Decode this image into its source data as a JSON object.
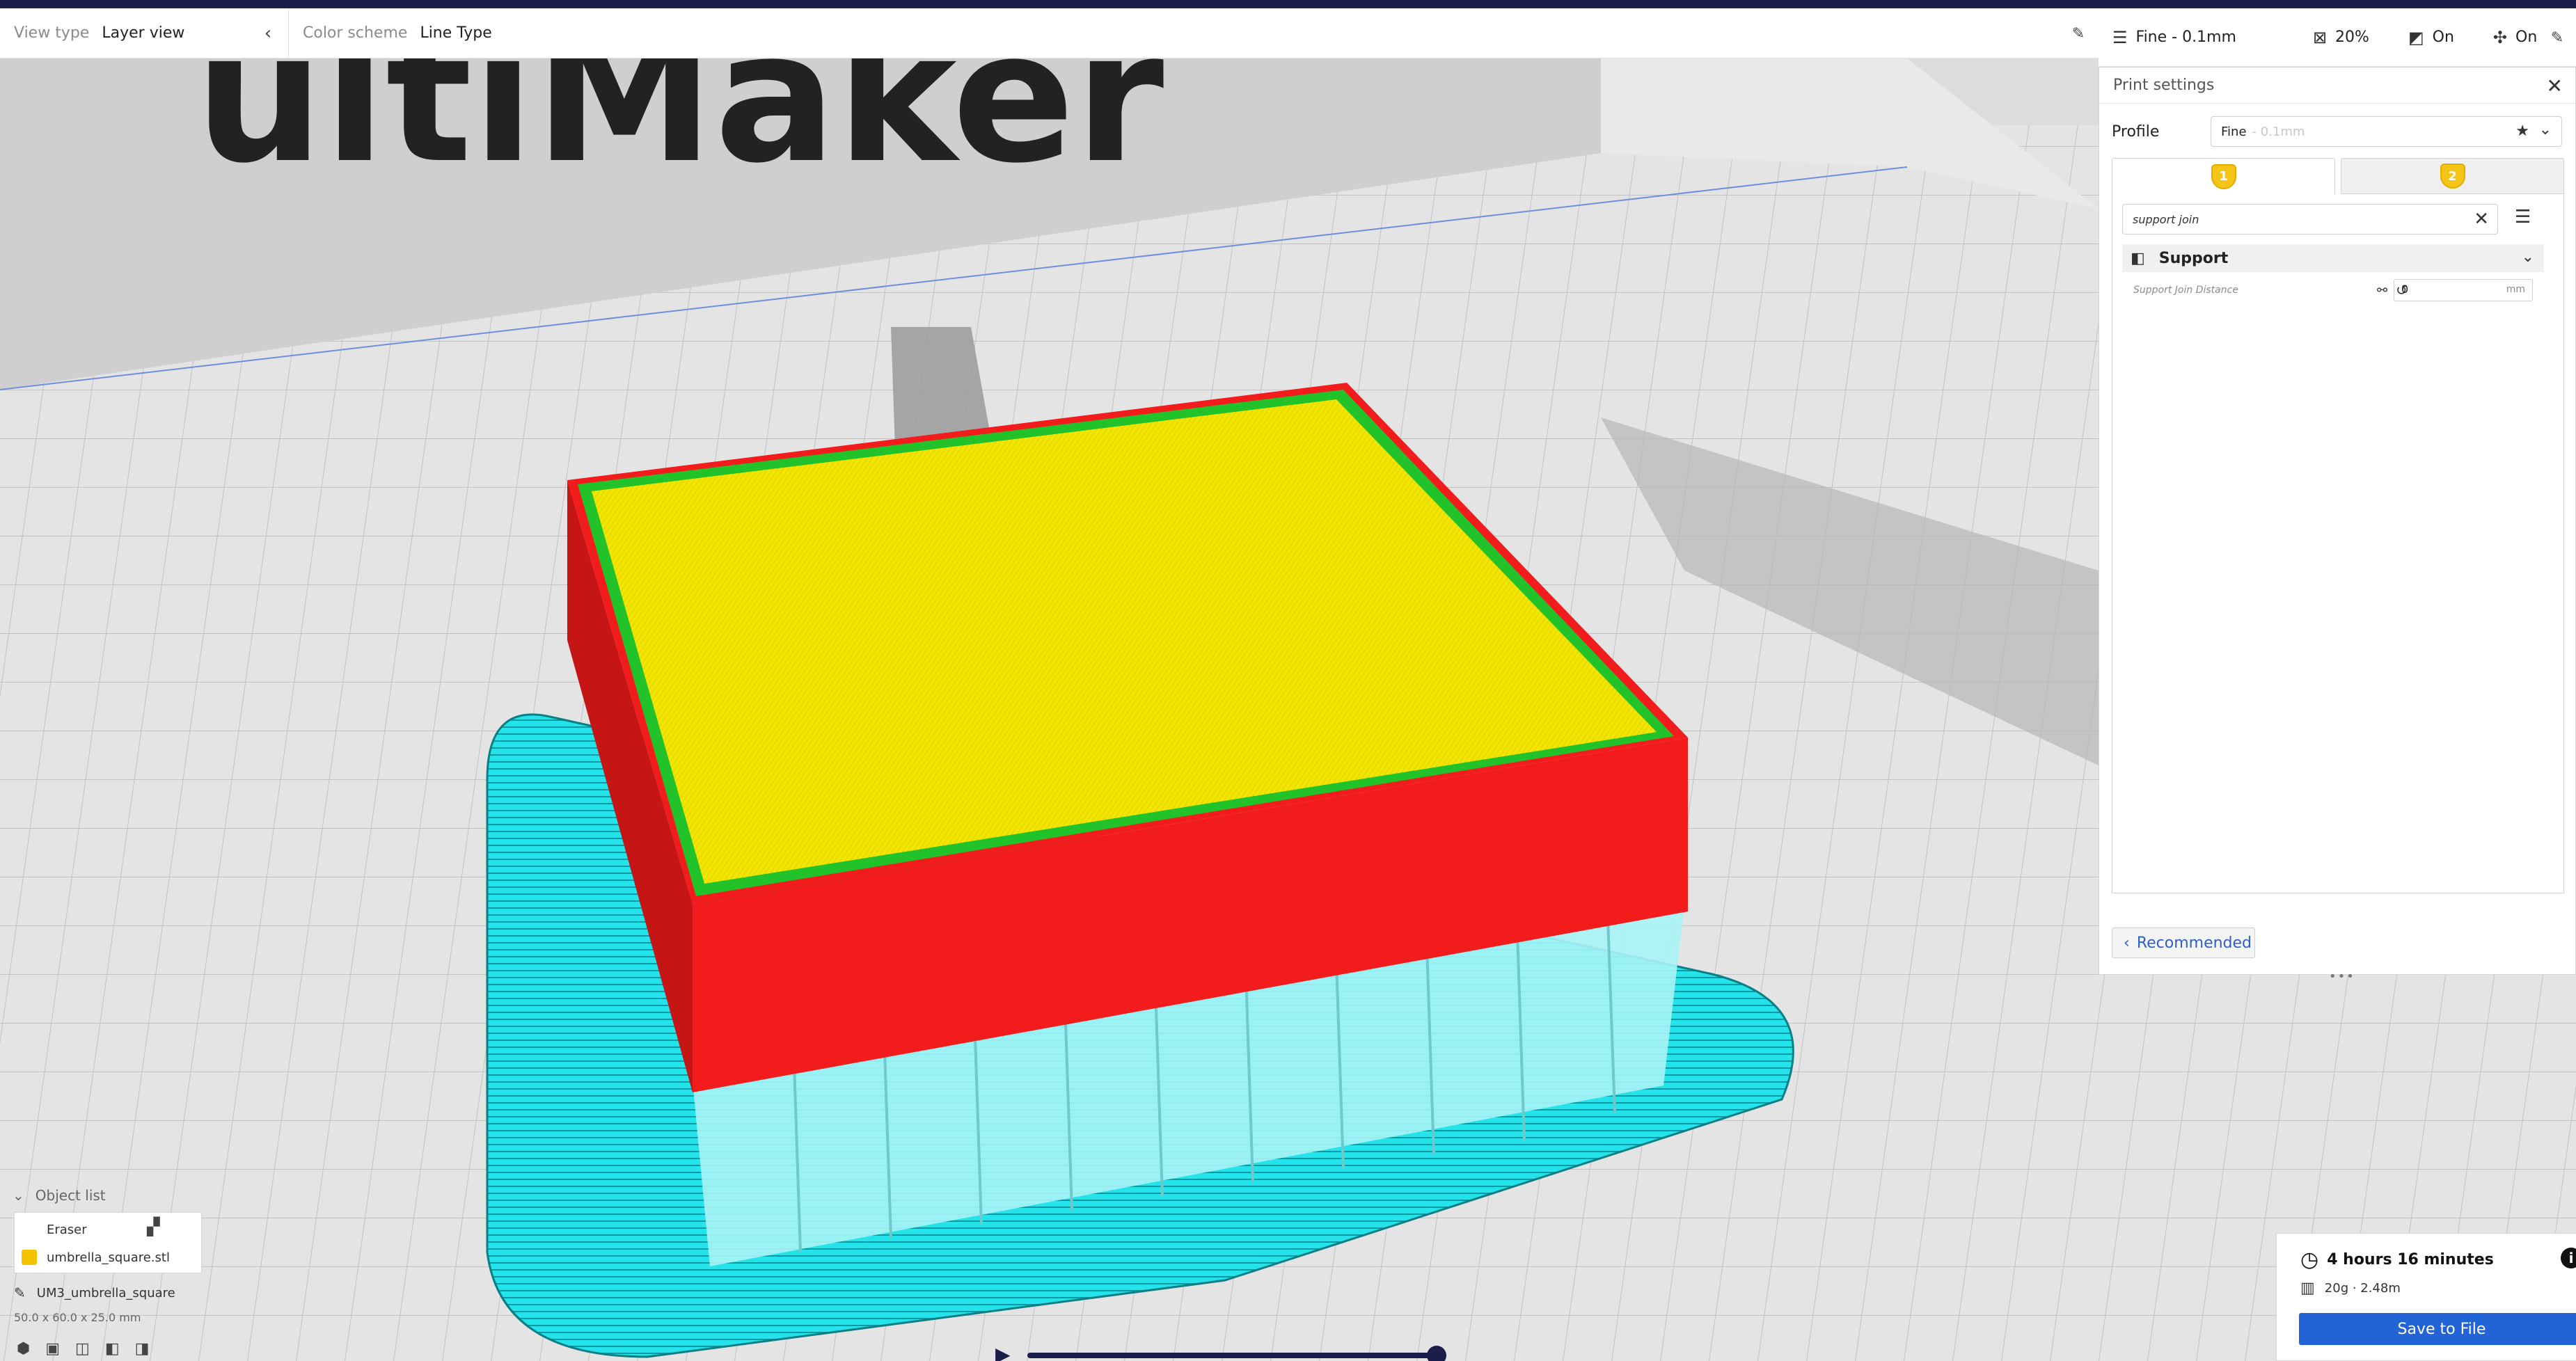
{
  "header": {
    "view_type_label": "View type",
    "view_type_value": "Layer view",
    "color_scheme_label": "Color scheme",
    "color_scheme_value": "Line Type"
  },
  "quick_settings": {
    "profile": "Fine - 0.1mm",
    "infill": "20%",
    "support": "On",
    "adhesion": "On"
  },
  "scene": {
    "backdrop_logo_text": "ultiMaker"
  },
  "print_settings": {
    "title": "Print settings",
    "profile_label": "Profile",
    "profile_name": "Fine",
    "profile_sub": "- 0.1mm",
    "extruders": [
      "1",
      "2"
    ],
    "search_value": "support join",
    "category": "Support",
    "setting_name": "Support Join Distance",
    "setting_value": "0",
    "setting_unit": "mm",
    "recommended_label": "Recommended"
  },
  "object_list": {
    "header": "Object list",
    "items": [
      {
        "name": "Eraser"
      },
      {
        "name": "umbrella_square.stl"
      }
    ],
    "job_name": "UM3_umbrella_square",
    "dimensions": "50.0 x 60.0 x 25.0 mm"
  },
  "estimate": {
    "time": "4 hours 16 minutes",
    "material": "20g · 2.48m",
    "save_label": "Save to File"
  },
  "colors": {
    "accent": "#2264d6",
    "header_strip": "#1b1e4b",
    "wall": "#f21c1c",
    "top_skin": "#f2e600",
    "inner_wall": "#22c22a",
    "support": "#24e3ea",
    "extruder_badge": "#f4c417"
  }
}
